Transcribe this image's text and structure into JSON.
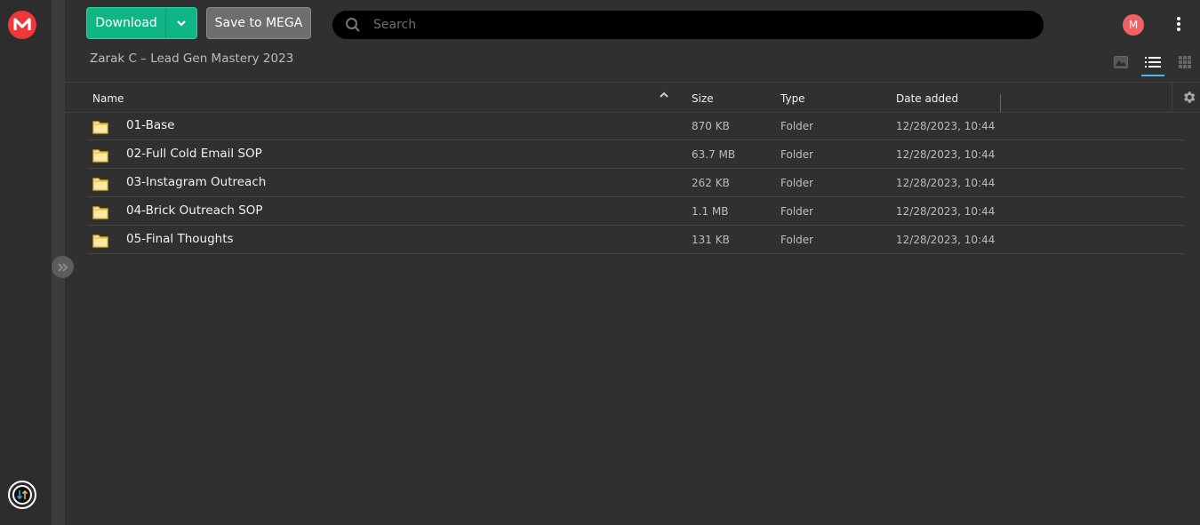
{
  "app": {
    "logo_letter": "M",
    "brand_color": "#f0373a",
    "accent_color": "#10b585"
  },
  "toolbar": {
    "download_label": "Download",
    "save_label": "Save to MEGA",
    "search_placeholder": "Search",
    "search_value": "",
    "avatar_initial": "M"
  },
  "breadcrumb": {
    "title": "Zarak C – Lead Gen Mastery 2023"
  },
  "view_modes": [
    {
      "name": "thumbnail-view",
      "active": false
    },
    {
      "name": "list-view",
      "active": true
    },
    {
      "name": "grid-view",
      "active": false
    }
  ],
  "table": {
    "columns": {
      "name": "Name",
      "size": "Size",
      "type": "Type",
      "date": "Date added"
    },
    "sort": {
      "column": "name",
      "direction": "ascending"
    },
    "rows": [
      {
        "name": "01-Base",
        "size": "870 KB",
        "type": "Folder",
        "date": "12/28/2023, 10:44"
      },
      {
        "name": "02-Full Cold Email SOP",
        "size": "63.7 MB",
        "type": "Folder",
        "date": "12/28/2023, 10:44"
      },
      {
        "name": "03-Instagram Outreach",
        "size": "262 KB",
        "type": "Folder",
        "date": "12/28/2023, 10:44"
      },
      {
        "name": "04-Brick Outreach SOP",
        "size": "1.1 MB",
        "type": "Folder",
        "date": "12/28/2023, 10:44"
      },
      {
        "name": "05-Final Thoughts",
        "size": "131 KB",
        "type": "Folder",
        "date": "12/28/2023, 10:44"
      }
    ]
  }
}
